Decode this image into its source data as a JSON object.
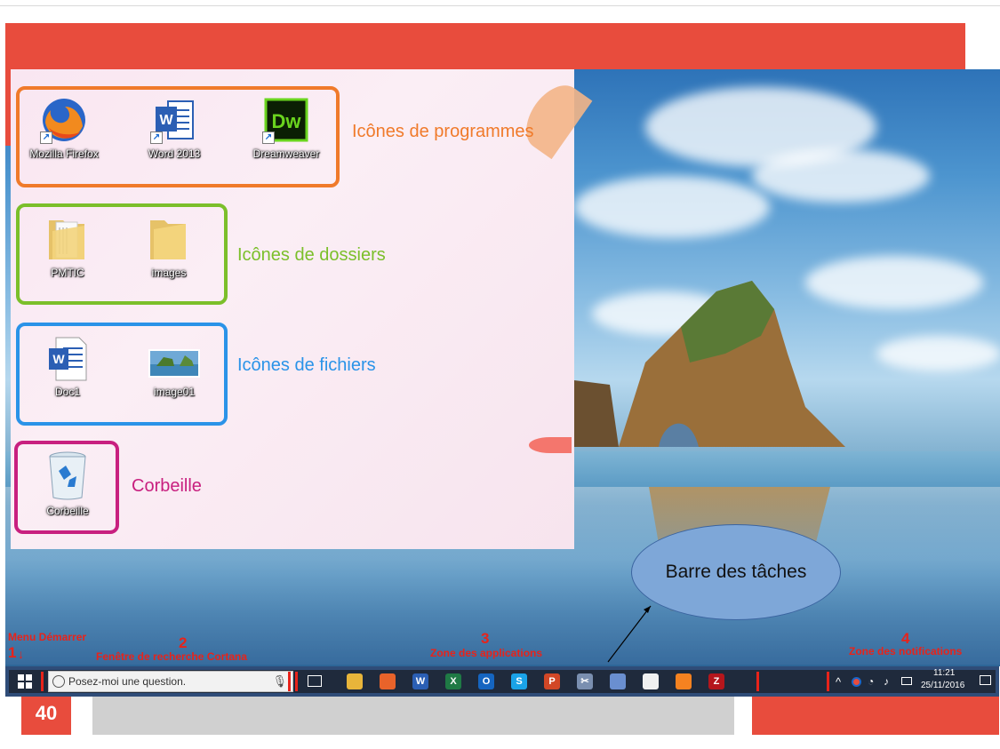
{
  "slide": {
    "page_number": "40"
  },
  "panel": {
    "groups": {
      "programs": {
        "label": "Icônes de programmes",
        "color": "#f07a2a"
      },
      "folders": {
        "label": "Icônes de dossiers",
        "color": "#7bbf2a"
      },
      "files": {
        "label": "Icônes de fichiers",
        "color": "#2a93e8"
      },
      "recycle": {
        "label": "Corbeille",
        "color": "#c8207f"
      }
    },
    "icons": {
      "firefox": "Mozilla Firefox",
      "word": "Word 2013",
      "dreamweaver": "Dreamweaver",
      "folder1": "PMTIC",
      "folder2": "images",
      "doc": "Doc1",
      "image": "image01",
      "recycle": "Corbeille"
    },
    "icon_glyphs": {
      "word": "W",
      "dreamweaver": "Dw"
    }
  },
  "callout": {
    "text": "Barre des tâches"
  },
  "annotations": {
    "start": {
      "number": "1",
      "label": "Menu Démarrer"
    },
    "cortana": {
      "number": "2",
      "label": "Fenêtre de recherche Cortana"
    },
    "apps": {
      "number": "3",
      "label": "Zone des applications"
    },
    "notifications": {
      "number": "4",
      "label": "Zone des notifications"
    }
  },
  "taskbar": {
    "search_placeholder": "Posez-moi une question.",
    "time": "11:21",
    "date": "25/11/2016",
    "app_icons": [
      {
        "name": "file-explorer-icon",
        "color": "#e8b53a",
        "glyph": ""
      },
      {
        "name": "firefox-icon",
        "color": "#e8632a",
        "glyph": ""
      },
      {
        "name": "word-icon",
        "color": "#2b5fb4",
        "glyph": "W"
      },
      {
        "name": "excel-icon",
        "color": "#1f7a45",
        "glyph": "X"
      },
      {
        "name": "outlook-icon",
        "color": "#1565c0",
        "glyph": "O"
      },
      {
        "name": "skype-icon",
        "color": "#1aa3e8",
        "glyph": "S"
      },
      {
        "name": "powerpoint-icon",
        "color": "#d24726",
        "glyph": "P"
      },
      {
        "name": "snipping-tool-icon",
        "color": "#7a8fb0",
        "glyph": "✂"
      },
      {
        "name": "paint-icon",
        "color": "#6a8fd0",
        "glyph": ""
      },
      {
        "name": "notepad-icon",
        "color": "#f0f0f0",
        "glyph": ""
      },
      {
        "name": "xampp-icon",
        "color": "#f58220",
        "glyph": ""
      },
      {
        "name": "filezilla-icon",
        "color": "#b5161c",
        "glyph": "Z"
      }
    ]
  },
  "colors": {
    "accent_red": "#e84c3d",
    "annotation_red": "#e8231a",
    "taskbar_border": "#2f4c78"
  }
}
